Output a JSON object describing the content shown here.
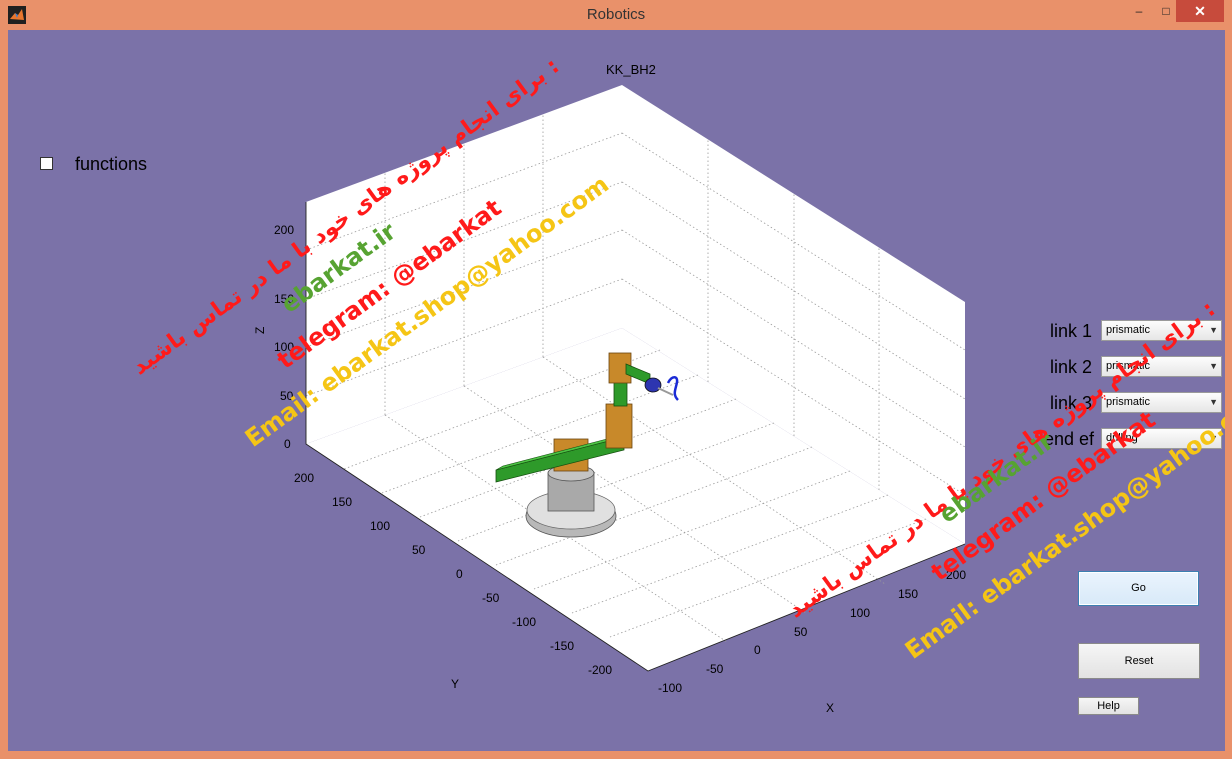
{
  "window": {
    "title": "Robotics",
    "minimize_label": "–",
    "maximize_label": "□",
    "close_label": "✕"
  },
  "functions_checkbox": {
    "label": "functions",
    "checked": false
  },
  "plot": {
    "title": "KK_BH2",
    "xlabel": "X",
    "ylabel": "Y",
    "zlabel": "Z",
    "x_ticks": [
      "-100",
      "-50",
      "0",
      "50",
      "100",
      "150",
      "200"
    ],
    "y_ticks": [
      "200",
      "150",
      "100",
      "50",
      "0",
      "-50",
      "-100",
      "-150",
      "-200"
    ],
    "z_ticks": [
      "0",
      "50",
      "100",
      "150",
      "200"
    ],
    "grid": true
  },
  "config": [
    {
      "label": "link 1",
      "value": "prismatic"
    },
    {
      "label": "link 2",
      "value": "prismatic"
    },
    {
      "label": "link 3",
      "value": "prismatic"
    },
    {
      "label": "end ef",
      "value": "drilling"
    }
  ],
  "buttons": {
    "go": "Go",
    "reset": "Reset",
    "help": "Help"
  },
  "watermark": {
    "persian": "برای انجام پروژه های خود با ما در تماس باشید :",
    "site": "ebarkat.ir",
    "telegram": "telegram: @ebarkat",
    "email": "Email: ebarkat.shop@yahoo.com"
  },
  "colors": {
    "figure_bg": "#7b72a8",
    "frame": "#e9916a",
    "watermark_red": "#ff1a1a",
    "watermark_green": "#57a332",
    "watermark_yellow": "#f5c515",
    "robot_link": "#2e9a2a",
    "robot_joint": "#c8892a",
    "robot_base": "#bfbfbf"
  }
}
